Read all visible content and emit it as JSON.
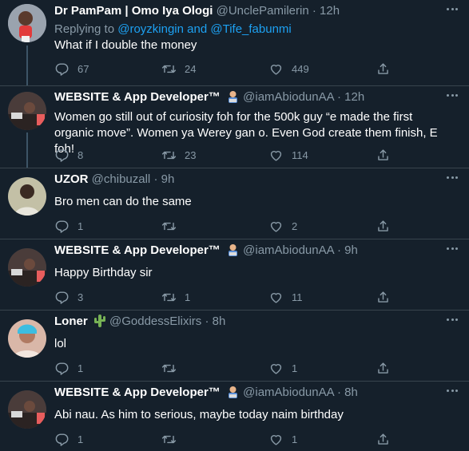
{
  "tweets": [
    {
      "name": "Dr PamPam | Omo Iya Ologi",
      "handle": "@UnclePamilerin",
      "time": "12h",
      "replying_prefix": "Replying to",
      "replying_user1": "@royzkingin",
      "replying_and": "and",
      "replying_user2": "@Tife_fabunmi",
      "text": "What if I double the money",
      "replies": "67",
      "retweets": "24",
      "likes": "449",
      "avatar_color": "#8a94a3"
    },
    {
      "name": "WEBSITE & App Developer™",
      "handle": "@iamAbiodunAA",
      "time": "12h",
      "text_line1": "Women go still out of curiosity foh for the 500k guy “e made the first",
      "text_line2": "organic move”. Women ya Werey gan o. Even God create them finish, E foh!",
      "replies": "8",
      "retweets": "23",
      "likes": "114",
      "avatar_color": "#3b3130"
    },
    {
      "name": "UZOR",
      "handle": "@chibuzall",
      "time": "9h",
      "text": "Bro men can do the same",
      "replies": "1",
      "retweets": "",
      "likes": "2",
      "avatar_color": "#b7b49a"
    },
    {
      "name": "WEBSITE & App Developer™",
      "handle": "@iamAbiodunAA",
      "time": "9h",
      "text": "Happy Birthday sir",
      "replies": "3",
      "retweets": "1",
      "likes": "11",
      "avatar_color": "#3b3130"
    },
    {
      "name": "Loner",
      "handle": "@GoddessElixirs",
      "time": "8h",
      "text": "lol",
      "replies": "1",
      "retweets": "",
      "likes": "1",
      "avatar_color": "#c9a08c"
    },
    {
      "name": "WEBSITE & App Developer™",
      "handle": "@iamAbiodunAA",
      "time": "8h",
      "text": "Abi nau. As him to serious, maybe today naim birthday",
      "replies": "1",
      "retweets": "",
      "likes": "1",
      "avatar_color": "#3b3130"
    }
  ],
  "dot": "·",
  "colors": {
    "background": "#15202b",
    "secondary_text": "#8899a6",
    "link": "#1da1f2",
    "divider": "#38444d"
  }
}
